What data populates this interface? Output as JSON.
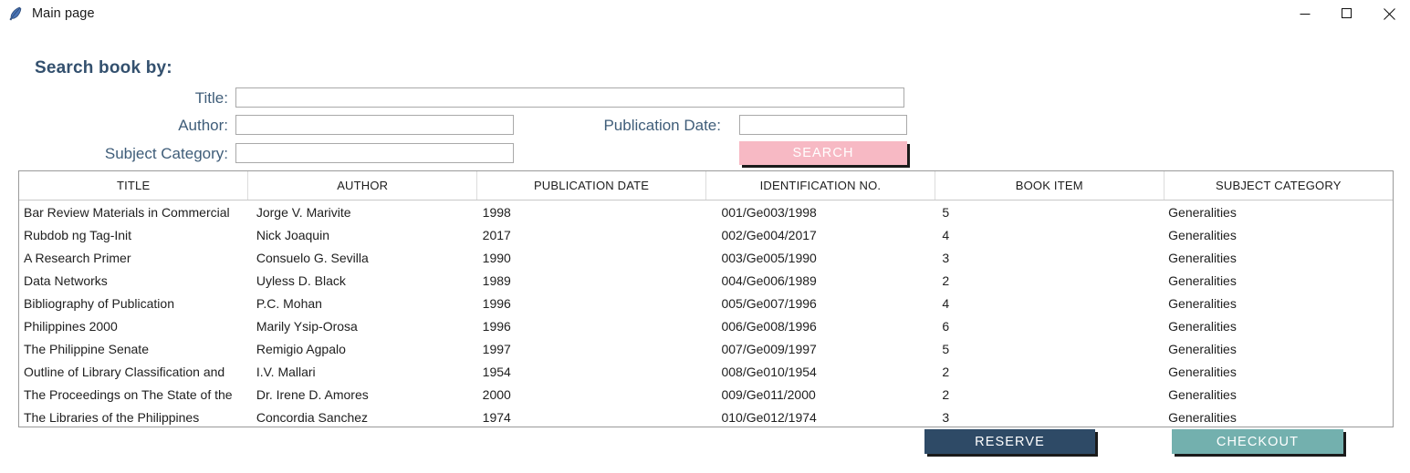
{
  "window": {
    "title": "Main page",
    "app_icon": "feather-icon",
    "controls": {
      "minimize": "minimize-icon",
      "maximize": "maximize-icon",
      "close": "close-icon"
    }
  },
  "search_form": {
    "heading": "Search book by:",
    "fields": {
      "title": {
        "label": "Title:",
        "value": "",
        "placeholder": ""
      },
      "author": {
        "label": "Author:",
        "value": "",
        "placeholder": ""
      },
      "subject_category": {
        "label": "Subject Category:",
        "value": "",
        "placeholder": ""
      },
      "publication_date": {
        "label": "Publication Date:",
        "value": "",
        "placeholder": ""
      }
    },
    "search_button": "SEARCH"
  },
  "table": {
    "columns": [
      "TITLE",
      "AUTHOR",
      "PUBLICATION DATE",
      "IDENTIFICATION NO.",
      "BOOK ITEM",
      "SUBJECT CATEGORY"
    ],
    "rows": [
      [
        "Bar Review Materials in Commercial",
        "Jorge V. Marivite",
        "1998",
        "001/Ge003/1998",
        "5",
        "Generalities"
      ],
      [
        "Rubdob ng Tag-Init",
        "Nick Joaquin",
        "2017",
        "002/Ge004/2017",
        "4",
        "Generalities"
      ],
      [
        "A Research Primer",
        "Consuelo G. Sevilla",
        "1990",
        "003/Ge005/1990",
        "3",
        "Generalities"
      ],
      [
        "Data Networks",
        "Uyless D. Black",
        "1989",
        "004/Ge006/1989",
        "2",
        "Generalities"
      ],
      [
        "Bibliography of Publication",
        "P.C. Mohan",
        "1996",
        "005/Ge007/1996",
        "4",
        "Generalities"
      ],
      [
        "Philippines 2000",
        "Marily Ysip-Orosa",
        "1996",
        "006/Ge008/1996",
        "6",
        "Generalities"
      ],
      [
        "The Philippine Senate",
        "Remigio Agpalo",
        "1997",
        "007/Ge009/1997",
        "5",
        "Generalities"
      ],
      [
        "Outline of Library Classification and ",
        "I.V. Mallari",
        "1954",
        "008/Ge010/1954",
        "2",
        "Generalities"
      ],
      [
        "The Proceedings on The State of the ",
        "Dr. Irene D. Amores",
        "2000",
        "009/Ge011/2000",
        "2",
        "Generalities"
      ],
      [
        "The Libraries of the Philippines",
        "Concordia Sanchez",
        "1974",
        "010/Ge012/1974",
        "3",
        "Generalities"
      ]
    ]
  },
  "actions": {
    "reserve": "RESERVE",
    "checkout": "CHECKOUT"
  },
  "colors": {
    "heading": "#33506e",
    "label": "#3f5d79",
    "search_button": "#f7b9c4",
    "reserve_button": "#2e4a66",
    "checkout_button": "#73b0ae"
  }
}
